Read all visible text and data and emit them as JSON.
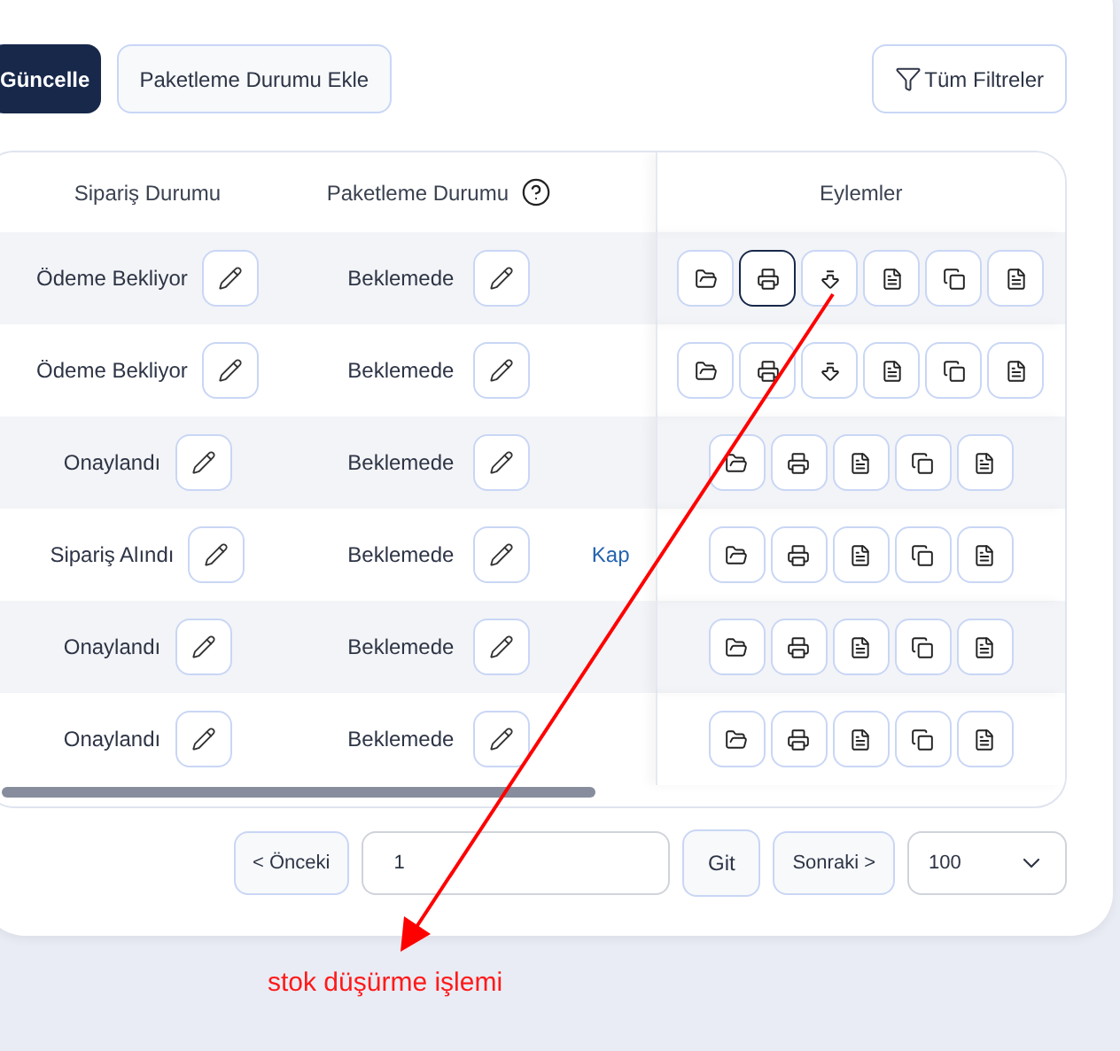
{
  "toolbar": {
    "buttons": [
      {
        "label": "Güncelle",
        "kind": "primary"
      },
      {
        "label": "Paketleme Durumu Ekle",
        "kind": "secondary"
      }
    ],
    "filter_button": "Tüm Filtreler"
  },
  "table": {
    "columns": [
      "Sipariş Durumu",
      "Paketleme Durumu",
      "Eylemler"
    ],
    "rows": [
      {
        "order_status": "Ödeme Bekliyor",
        "packaging_status": "Beklemede",
        "actions": [
          {
            "kind": "folder",
            "selected": false
          },
          {
            "kind": "print",
            "selected": true
          },
          {
            "kind": "stock-down",
            "selected": false
          },
          {
            "kind": "document",
            "selected": false
          },
          {
            "kind": "copy",
            "selected": false
          },
          {
            "kind": "document",
            "selected": false
          }
        ]
      },
      {
        "order_status": "Ödeme Bekliyor",
        "packaging_status": "Beklemede",
        "actions": [
          {
            "kind": "folder",
            "selected": false
          },
          {
            "kind": "print",
            "selected": false
          },
          {
            "kind": "stock-down",
            "selected": false
          },
          {
            "kind": "document",
            "selected": false
          },
          {
            "kind": "copy",
            "selected": false
          },
          {
            "kind": "document",
            "selected": false
          }
        ]
      },
      {
        "order_status": "Onaylandı",
        "packaging_status": "Beklemede",
        "actions": [
          {
            "kind": "folder",
            "selected": false
          },
          {
            "kind": "print",
            "selected": false
          },
          {
            "kind": "document",
            "selected": false
          },
          {
            "kind": "copy",
            "selected": false
          },
          {
            "kind": "document",
            "selected": false
          }
        ]
      },
      {
        "order_status": "Sipariş Alındı",
        "packaging_status": "Beklemede",
        "column_3": "Kap",
        "actions": [
          {
            "kind": "folder",
            "selected": false
          },
          {
            "kind": "print",
            "selected": false
          },
          {
            "kind": "document",
            "selected": false
          },
          {
            "kind": "copy",
            "selected": false
          },
          {
            "kind": "document",
            "selected": false
          }
        ]
      },
      {
        "order_status": "Onaylandı",
        "packaging_status": "Beklemede",
        "actions": [
          {
            "kind": "folder",
            "selected": false
          },
          {
            "kind": "print",
            "selected": false
          },
          {
            "kind": "document",
            "selected": false
          },
          {
            "kind": "copy",
            "selected": false
          },
          {
            "kind": "document",
            "selected": false
          }
        ]
      },
      {
        "order_status": "Onaylandı",
        "packaging_status": "Beklemede",
        "actions": [
          {
            "kind": "folder",
            "selected": false
          },
          {
            "kind": "print",
            "selected": false
          },
          {
            "kind": "document",
            "selected": false
          },
          {
            "kind": "copy",
            "selected": false
          },
          {
            "kind": "document",
            "selected": false
          }
        ]
      }
    ]
  },
  "pagination": {
    "previous": "< Önceki",
    "page": "1",
    "go": "Git",
    "next": "Sonraki >",
    "page_size": "100"
  },
  "annotation": {
    "text": "stok düşürme işlemi"
  }
}
